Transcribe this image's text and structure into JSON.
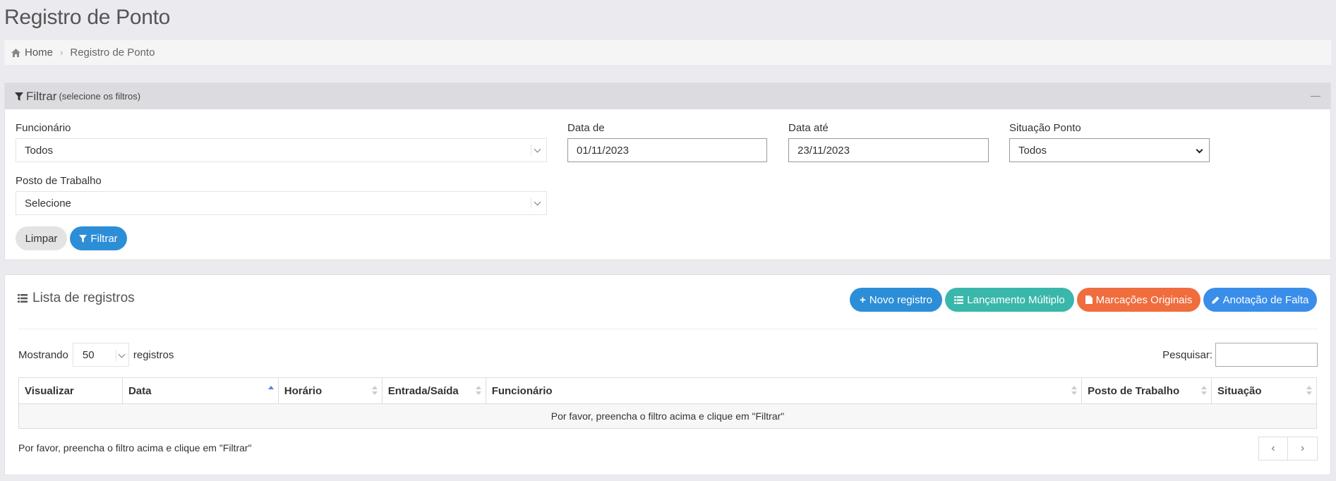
{
  "page": {
    "title": "Registro de Ponto"
  },
  "breadcrumb": {
    "home": "Home",
    "current": "Registro de Ponto"
  },
  "filter": {
    "title": "Filtrar",
    "subtitle": "(selecione os filtros)",
    "employee": {
      "label": "Funcionário",
      "value": "Todos"
    },
    "date_from": {
      "label": "Data de",
      "value": "01/11/2023"
    },
    "date_to": {
      "label": "Data até",
      "value": "23/11/2023"
    },
    "status": {
      "label": "Situação Ponto",
      "value": "Todos"
    },
    "workplace": {
      "label": "Posto de Trabalho",
      "value": "Selecione"
    },
    "clear_label": "Limpar",
    "filter_label": "Filtrar"
  },
  "list": {
    "title": "Lista de registros",
    "actions": {
      "new": "Novo registro",
      "multiple": "Lançamento Múltiplo",
      "originals": "Marcações Originais",
      "absence": "Anotação de Falta"
    },
    "length": {
      "prefix": "Mostrando",
      "value": "50",
      "suffix": "registros"
    },
    "search_label": "Pesquisar:",
    "columns": [
      "Visualizar",
      "Data",
      "Horário",
      "Entrada/Saída",
      "Funcionário",
      "Posto de Trabalho",
      "Situação"
    ],
    "empty_message": "Por favor, preencha o filtro acima e clique em \"Filtrar\"",
    "info": "Por favor, preencha o filtro acima e clique em \"Filtrar\""
  },
  "colors": {
    "primary": "#2d8ed8",
    "teal": "#3ab7ab",
    "orange": "#f06d3e",
    "light_blue": "#3a8eea"
  }
}
